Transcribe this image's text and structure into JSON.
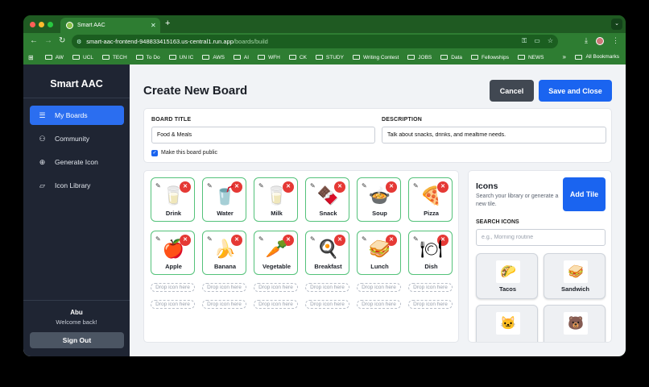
{
  "browser": {
    "tab_title": "Smart AAC",
    "url_host": "smart-aac-frontend-948833415163.us-central1.run.app",
    "url_path": "/boards/build",
    "bookmarks": [
      "AW",
      "UCL",
      "TECH",
      "To Do",
      "UN IC",
      "AWS",
      "AI",
      "WFH",
      "CK",
      "STUDY",
      "Writing Contest",
      "JOBS",
      "Data",
      "Fellowships",
      "NEWS"
    ],
    "bookmarks_more": "»",
    "all_bookmarks": "All Bookmarks"
  },
  "sidebar": {
    "brand": "Smart AAC",
    "items": [
      {
        "label": "My Boards",
        "icon": "menu-icon",
        "active": true
      },
      {
        "label": "Community",
        "icon": "people-icon",
        "active": false
      },
      {
        "label": "Generate Icon",
        "icon": "plus-circle-icon",
        "active": false
      },
      {
        "label": "Icon Library",
        "icon": "folder-icon",
        "active": false
      }
    ],
    "user_name": "Abu",
    "user_sub": "Welcome back!",
    "sign_out": "Sign Out"
  },
  "header": {
    "title": "Create New Board",
    "cancel": "Cancel",
    "save": "Save and Close"
  },
  "form": {
    "title_label": "BOARD TITLE",
    "title_value": "Food & Meals",
    "desc_label": "DESCRIPTION",
    "desc_value": "Talk about snacks, drinks, and mealtime needs.",
    "public_label": "Make this board public",
    "public_checked": true
  },
  "tiles": [
    {
      "label": "Drink",
      "glyph": "🥛"
    },
    {
      "label": "Water",
      "glyph": "🥤"
    },
    {
      "label": "Milk",
      "glyph": "🥛"
    },
    {
      "label": "Snack",
      "glyph": "🍫"
    },
    {
      "label": "Soup",
      "glyph": "🍲"
    },
    {
      "label": "Pizza",
      "glyph": "🍕"
    },
    {
      "label": "Apple",
      "glyph": "🍎"
    },
    {
      "label": "Banana",
      "glyph": "🍌"
    },
    {
      "label": "Vegetable",
      "glyph": "🥕"
    },
    {
      "label": "Breakfast",
      "glyph": "🍳"
    },
    {
      "label": "Lunch",
      "glyph": "🥪"
    },
    {
      "label": "Dish",
      "glyph": "🍽"
    }
  ],
  "drop_text": "Drop icon here",
  "icons_panel": {
    "title": "Icons",
    "subtitle": "Search your library or generate a new tile.",
    "add_tile": "Add Tile",
    "search_label": "SEARCH ICONS",
    "search_placeholder": "e.g., Morning routine",
    "results": [
      {
        "name": "Tacos",
        "glyph": "🌮"
      },
      {
        "name": "Sandwich",
        "glyph": "🥪"
      },
      {
        "name": "",
        "glyph": "🐱"
      },
      {
        "name": "",
        "glyph": "🐻"
      }
    ]
  }
}
